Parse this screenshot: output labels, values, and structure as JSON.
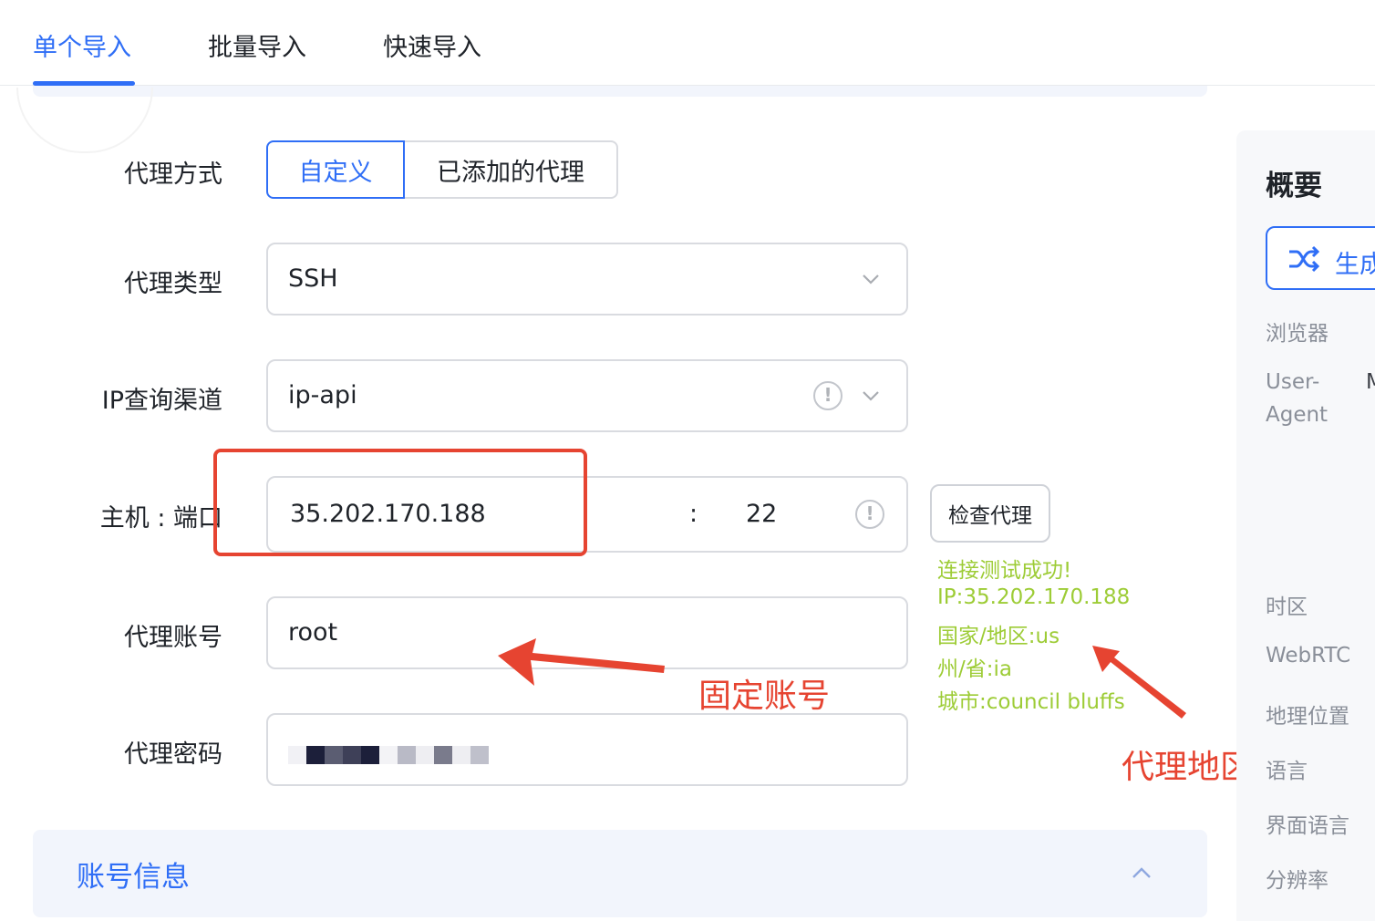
{
  "tabs": [
    {
      "label": "单个导入",
      "active": true
    },
    {
      "label": "批量导入",
      "active": false
    },
    {
      "label": "快速导入",
      "active": false
    }
  ],
  "form": {
    "proxy_mode": {
      "label": "代理方式",
      "options": [
        "自定义",
        "已添加的代理"
      ],
      "selected": "自定义"
    },
    "proxy_type": {
      "label": "代理类型",
      "value": "SSH"
    },
    "ip_channel": {
      "label": "IP查询渠道",
      "value": "ip-api"
    },
    "host_port": {
      "label": "主机 : 端口",
      "host": "35.202.170.188",
      "separator": ":",
      "port": "22"
    },
    "account": {
      "label": "代理账号",
      "value": "root"
    },
    "password": {
      "label": "代理密码"
    },
    "check_button": "检查代理"
  },
  "check_result": {
    "status": "连接测试成功!",
    "ip": "IP:35.202.170.188",
    "country": "国家/地区:us",
    "state": "州/省:ia",
    "city": "城市:council bluffs"
  },
  "annotations": {
    "fixed_account": "固定账号",
    "proxy_region": "代理地区"
  },
  "account_section": {
    "title": "账号信息"
  },
  "overview": {
    "title": "概要",
    "generate_button": "生成",
    "items": {
      "browser": "浏览器",
      "ua_line1": "User-",
      "ua_line2": "Agent",
      "ua_value_fragment": "M",
      "timezone": "时区",
      "webrtc": "WebRTC",
      "geolocation": "地理位置",
      "language": "语言",
      "ui_language": "界面语言",
      "resolution": "分辨率"
    }
  },
  "colors": {
    "accent": "#2f6ef6",
    "success": "#9dcc36",
    "annotation": "#e64431"
  }
}
